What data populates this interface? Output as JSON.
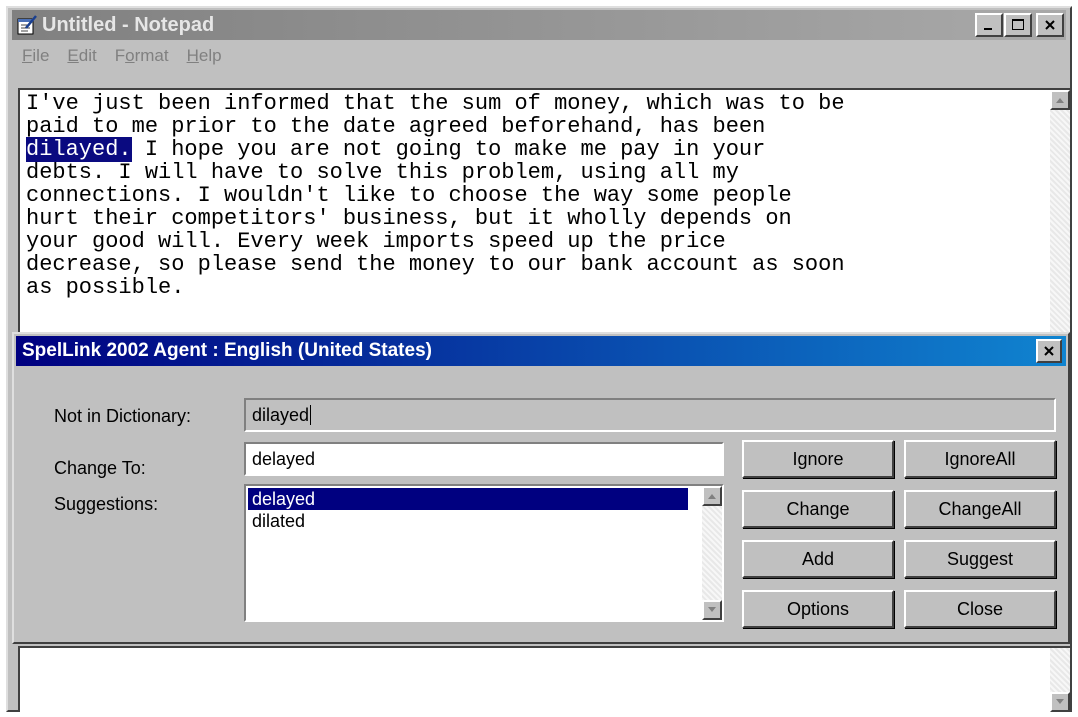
{
  "window": {
    "title": "Untitled - Notepad",
    "minimize_label": "_",
    "close_label": "✕"
  },
  "menu": {
    "file": {
      "mnemonic": "F",
      "rest": "ile"
    },
    "edit": {
      "mnemonic": "E",
      "rest": "dit"
    },
    "format": {
      "pre": "F",
      "mnemonic": "o",
      "rest": "rmat"
    },
    "help": {
      "mnemonic": "H",
      "rest": "elp"
    }
  },
  "editor": {
    "lines": [
      "I've just been informed that the sum of money, which was to be",
      "paid to me prior to the date agreed beforehand, has been",
      "",
      "debts. I will have to solve this problem, using all my",
      "connections. I wouldn't like to choose the way some people",
      "hurt their competitors' business, but it wholly depends on",
      "your good will. Every week imports speed up the price",
      "decrease, so please send the money to our bank account as soon",
      "as possible."
    ],
    "line3_selected": "dilayed.",
    "line3_rest": " I hope you are not going to make me pay in your"
  },
  "dialog": {
    "title": "SpelLink 2002 Agent : English (United States)",
    "close_label": "✕",
    "not_in_dictionary_label": "Not in Dictionary:",
    "not_in_dictionary_value": "dilayed",
    "change_to_label": "Change To:",
    "change_to_value": "delayed",
    "suggestions_label": "Suggestions:",
    "suggestions": [
      "delayed",
      "dilated"
    ],
    "buttons": {
      "ignore": "Ignore",
      "ignore_all": "IgnoreAll",
      "change": "Change",
      "change_all": "ChangeAll",
      "add": "Add",
      "suggest": "Suggest",
      "options": "Options",
      "close": "Close"
    }
  },
  "colors": {
    "dialog_title_bar": "#000080",
    "selection": "#000080",
    "inactive_title_bar": "#808080"
  }
}
